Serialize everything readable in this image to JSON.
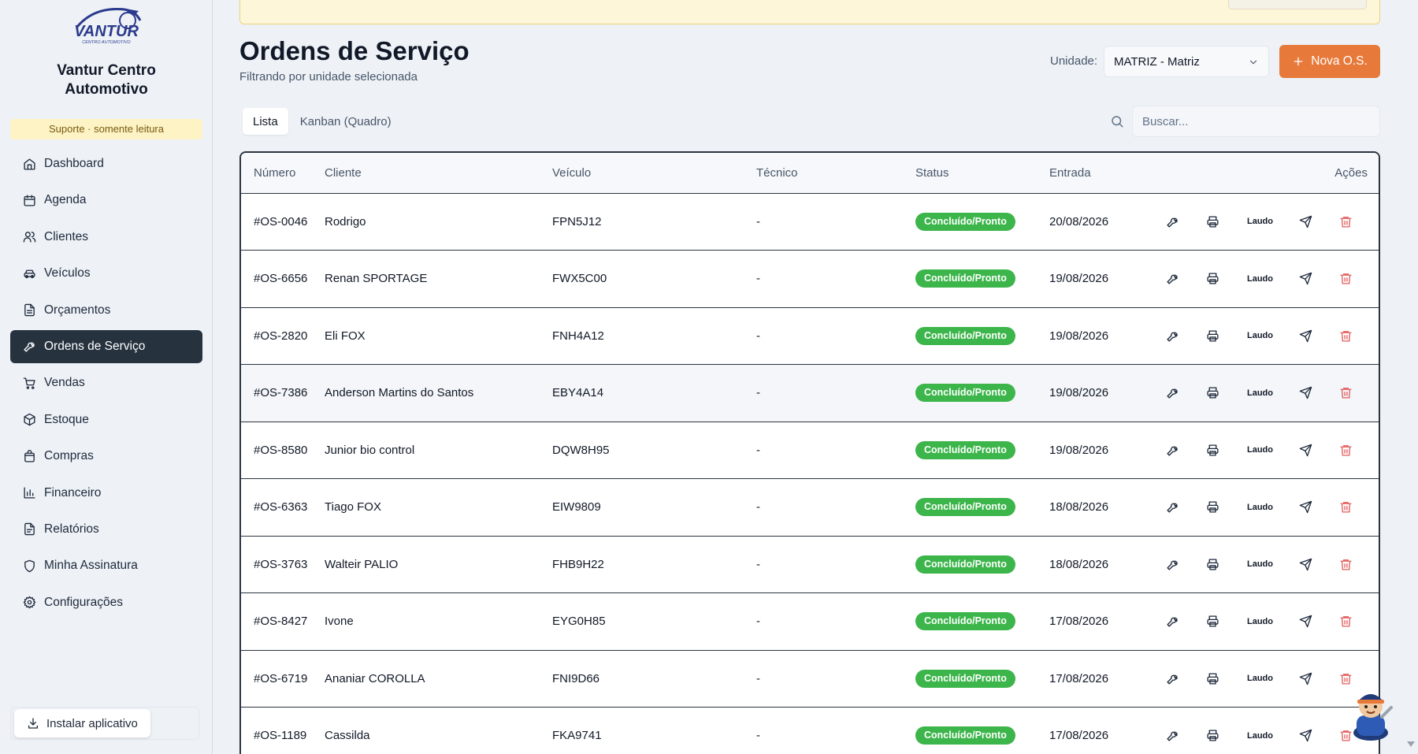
{
  "sidebar": {
    "brand": "Vantur Centro Automotivo",
    "logo_text": "VANTUR",
    "logo_subtext": "CENTRO AUTOMOTIVO",
    "support_badge": "Suporte · somente leitura",
    "items": [
      {
        "label": "Dashboard",
        "icon": "home-icon"
      },
      {
        "label": "Agenda",
        "icon": "calendar-icon"
      },
      {
        "label": "Clientes",
        "icon": "users-icon"
      },
      {
        "label": "Veículos",
        "icon": "car-icon"
      },
      {
        "label": "Orçamentos",
        "icon": "file-text-icon"
      },
      {
        "label": "Ordens de Serviço",
        "icon": "wrench-icon",
        "active": true
      },
      {
        "label": "Vendas",
        "icon": "cart-icon"
      },
      {
        "label": "Estoque",
        "icon": "box-icon"
      },
      {
        "label": "Compras",
        "icon": "bag-icon"
      },
      {
        "label": "Financeiro",
        "icon": "bar-chart-icon"
      },
      {
        "label": "Relatórios",
        "icon": "report-icon"
      },
      {
        "label": "Minha Assinatura",
        "icon": "shield-icon"
      },
      {
        "label": "Configurações",
        "icon": "gear-icon"
      }
    ],
    "install_label": "Instalar aplicativo"
  },
  "header": {
    "title": "Ordens de Serviço",
    "subtitle": "Filtrando por unidade selecionada",
    "unit_label": "Unidade:",
    "unit_value": "MATRIZ - Matriz",
    "new_button": "Nova O.S."
  },
  "tabs": [
    {
      "label": "Lista",
      "active": true
    },
    {
      "label": "Kanban (Quadro)",
      "active": false
    }
  ],
  "search": {
    "placeholder": "Buscar..."
  },
  "table": {
    "columns": [
      "Número",
      "Cliente",
      "Veículo",
      "Técnico",
      "Status",
      "Entrada",
      "Ações"
    ],
    "action_laudo": "Laudo",
    "rows": [
      {
        "numero": "#OS-0046",
        "cliente": "Rodrigo",
        "veiculo": "FPN5J12",
        "tecnico": "-",
        "status": "Concluído/Pronto",
        "entrada": "20/08/2026"
      },
      {
        "numero": "#OS-6656",
        "cliente": "Renan SPORTAGE",
        "veiculo": "FWX5C00",
        "tecnico": "-",
        "status": "Concluído/Pronto",
        "entrada": "19/08/2026"
      },
      {
        "numero": "#OS-2820",
        "cliente": "Eli FOX",
        "veiculo": "FNH4A12",
        "tecnico": "-",
        "status": "Concluído/Pronto",
        "entrada": "19/08/2026"
      },
      {
        "numero": "#OS-7386",
        "cliente": "Anderson Martins do Santos",
        "veiculo": "EBY4A14",
        "tecnico": "-",
        "status": "Concluído/Pronto",
        "entrada": "19/08/2026"
      },
      {
        "numero": "#OS-8580",
        "cliente": "Junior bio control",
        "veiculo": "DQW8H95",
        "tecnico": "-",
        "status": "Concluído/Pronto",
        "entrada": "19/08/2026"
      },
      {
        "numero": "#OS-6363",
        "cliente": "Tiago FOX",
        "veiculo": "EIW9809",
        "tecnico": "-",
        "status": "Concluído/Pronto",
        "entrada": "18/08/2026"
      },
      {
        "numero": "#OS-3763",
        "cliente": "Walteir PALIO",
        "veiculo": "FHB9H22",
        "tecnico": "-",
        "status": "Concluído/Pronto",
        "entrada": "18/08/2026"
      },
      {
        "numero": "#OS-8427",
        "cliente": "Ivone",
        "veiculo": "EYG0H85",
        "tecnico": "-",
        "status": "Concluído/Pronto",
        "entrada": "17/08/2026"
      },
      {
        "numero": "#OS-6719",
        "cliente": "Ananiar COROLLA",
        "veiculo": "FNI9D66",
        "tecnico": "-",
        "status": "Concluído/Pronto",
        "entrada": "17/08/2026"
      },
      {
        "numero": "#OS-1189",
        "cliente": "Cassilda",
        "veiculo": "FKA9741",
        "tecnico": "-",
        "status": "Concluído/Pronto",
        "entrada": "17/08/2026"
      }
    ]
  },
  "colors": {
    "accent": "#e77a3b",
    "sidebar_active": "#27323f",
    "status_done": "#3cb54a",
    "delete": "#e25b5b",
    "banner": "#fdf6d8"
  }
}
